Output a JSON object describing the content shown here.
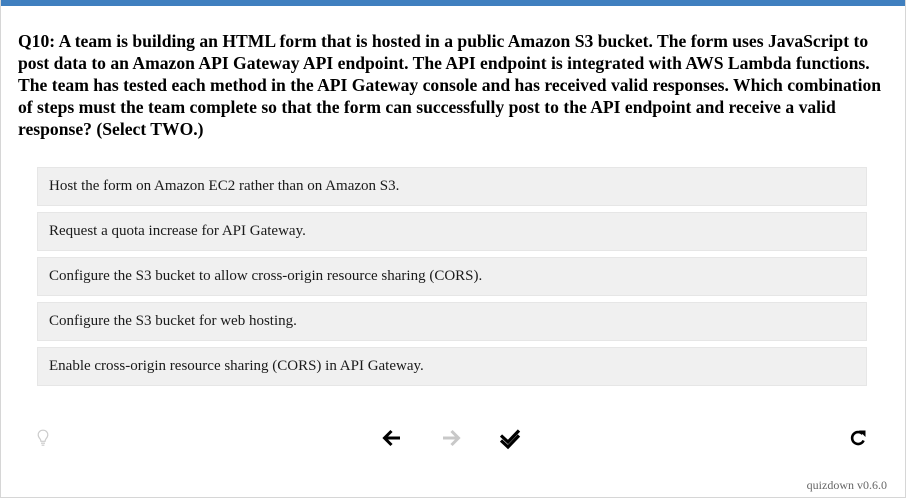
{
  "question": {
    "text": "Q10: A team is building an HTML form that is hosted in a public Amazon S3 bucket. The form uses JavaScript to post data to an Amazon API Gateway API endpoint. The API endpoint is integrated with AWS Lambda functions. The team has tested each method in the API Gateway console and has received valid responses. Which combination of steps must the team complete so that the form can successfully post to the API endpoint and receive a valid response? (Select TWO.)"
  },
  "options": [
    {
      "label": "Host the form on Amazon EC2 rather than on Amazon S3."
    },
    {
      "label": "Request a quota increase for API Gateway."
    },
    {
      "label": "Configure the S3 bucket to allow cross-origin resource sharing (CORS)."
    },
    {
      "label": "Configure the S3 bucket for web hosting."
    },
    {
      "label": "Enable cross-origin resource sharing (CORS) in API Gateway."
    }
  ],
  "controls": {
    "hint_icon": "lightbulb-icon",
    "back_icon": "arrow-left-icon",
    "forward_icon": "arrow-right-icon",
    "submit_icon": "double-check-icon",
    "reset_icon": "redo-icon"
  },
  "footer": {
    "version": "quizdown v0.6.0"
  },
  "colors": {
    "accent": "#3f7fbf",
    "option_background": "#f0f0f0",
    "disabled_icon": "#c8c8c8"
  }
}
